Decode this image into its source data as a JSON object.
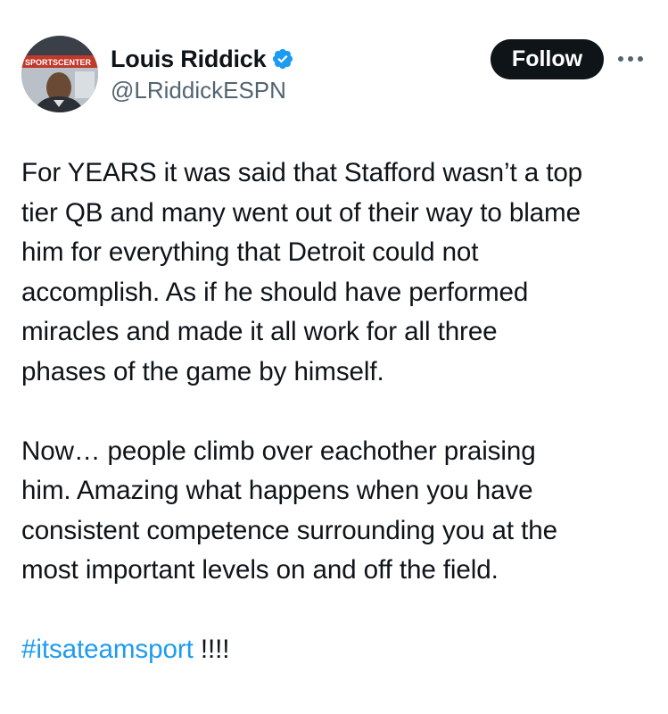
{
  "author": {
    "display_name": "Louis Riddick",
    "handle": "@LRiddickESPN",
    "verified": true,
    "avatar_banner_text": "SPORTSCENTER"
  },
  "actions": {
    "follow_label": "Follow",
    "more_icon": "more-horizontal-icon"
  },
  "tweet": {
    "paragraph_1_lines": [
      "For YEARS it was said that Stafford wasn’t a top",
      "tier QB and many went out of their way to blame",
      "him for everything that Detroit could not",
      "accomplish. As if he should have performed",
      "miracles and made it all work for all three",
      "phases of the game by himself."
    ],
    "paragraph_2_lines": [
      "Now… people climb over eachother praising",
      "him. Amazing what happens when you have",
      "consistent competence surrounding you at the",
      "most important levels on and off the field."
    ],
    "hashtag": "#itsateamsport",
    "suffix": " !!!!"
  },
  "colors": {
    "text": "#0f1419",
    "secondary": "#536471",
    "link": "#1d9bf0",
    "verified_badge": "#1d9bf0",
    "follow_bg": "#0f1419"
  }
}
